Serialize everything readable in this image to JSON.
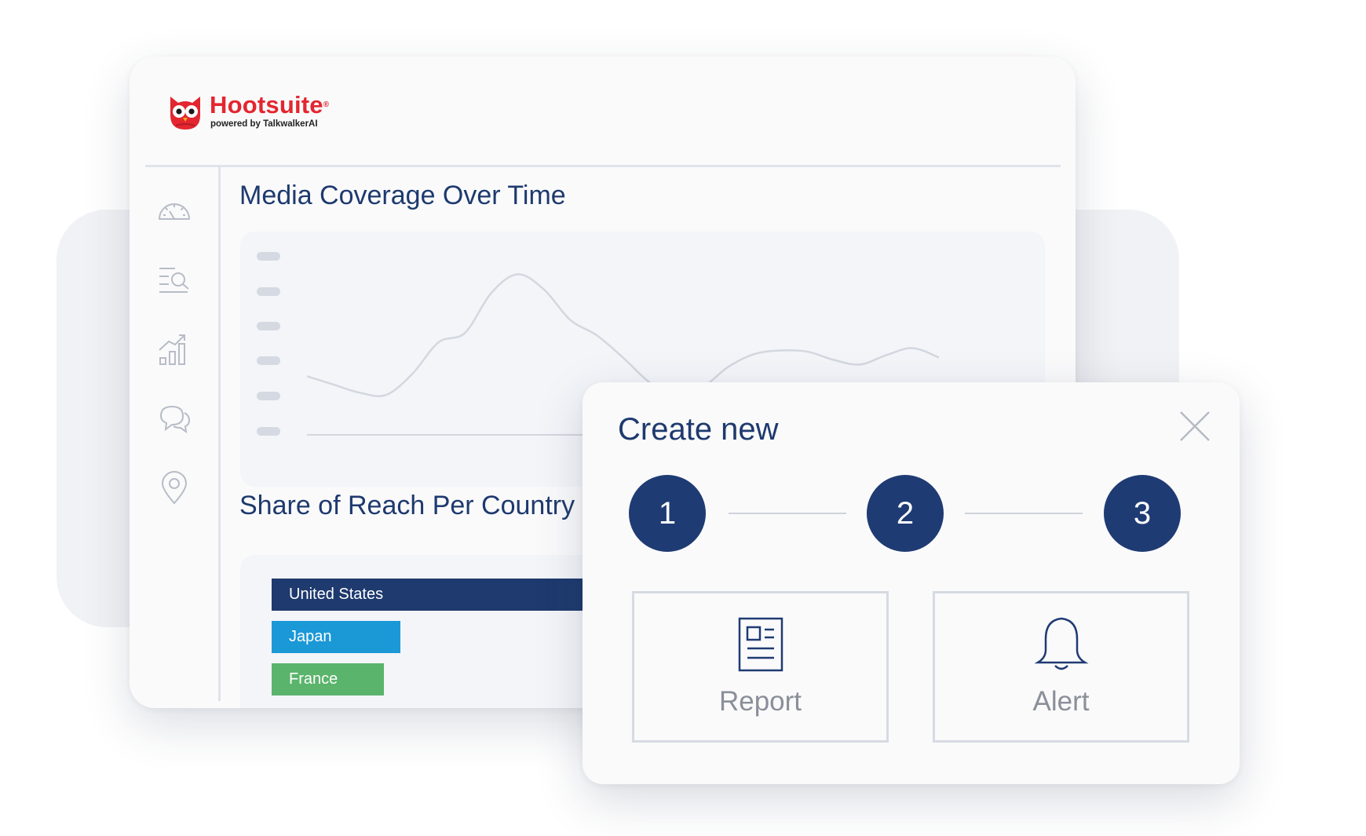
{
  "brand": {
    "name": "Hootsuite",
    "registered": "®",
    "tagline": "powered by TalkwalkerAI",
    "color": "#e3262f"
  },
  "sidebar": {
    "items": [
      {
        "icon": "dashboard-gauge-icon"
      },
      {
        "icon": "search-list-icon"
      },
      {
        "icon": "bar-chart-growth-icon"
      },
      {
        "icon": "chat-bubbles-icon"
      },
      {
        "icon": "location-pin-icon"
      }
    ]
  },
  "sections": {
    "media_coverage": {
      "title": "Media Coverage Over Time"
    },
    "share_of_reach": {
      "title": "Share of Reach Per Country"
    }
  },
  "chart_data": [
    {
      "type": "line",
      "title": "Media Coverage Over Time",
      "xlabel": "",
      "ylabel": "",
      "grid": false,
      "series": [
        {
          "values": [
            50,
            43,
            36,
            34,
            52,
            79,
            87,
            121,
            137,
            124,
            98,
            85,
            66,
            45,
            33,
            40,
            58,
            69,
            72,
            71,
            64,
            60,
            68,
            74,
            66
          ]
        }
      ],
      "ylim": [
        0,
        160
      ]
    },
    {
      "type": "bar",
      "title": "Share of Reach Per Country",
      "categories": [
        "United States",
        "Japan",
        "France"
      ],
      "values": [
        1.0,
        0.39,
        0.34
      ],
      "colors": [
        "#1e3a6e",
        "#1b98d6",
        "#5ab46b"
      ]
    }
  ],
  "modal": {
    "title": "Create new",
    "close_icon": "close-icon",
    "steps": [
      {
        "label": "1"
      },
      {
        "label": "2"
      },
      {
        "label": "3"
      }
    ],
    "options": [
      {
        "label": "Report",
        "icon": "report-document-icon"
      },
      {
        "label": "Alert",
        "icon": "bell-icon"
      }
    ]
  },
  "colors": {
    "primary": "#1f3b73",
    "heading": "#1e3a6e",
    "muted": "#8a8f99",
    "divider": "#e0e3e9"
  }
}
